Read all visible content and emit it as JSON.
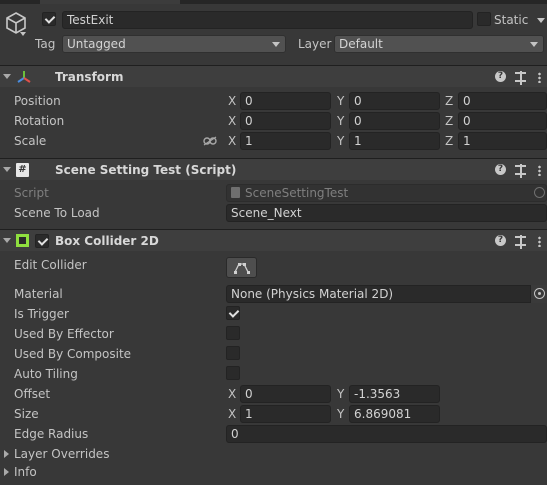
{
  "gameobject": {
    "name": "TestExit",
    "active": true,
    "static_label": "Static",
    "tag_label": "Tag",
    "tag_value": "Untagged",
    "layer_label": "Layer",
    "layer_value": "Default"
  },
  "transform": {
    "title": "Transform",
    "position_label": "Position",
    "rotation_label": "Rotation",
    "scale_label": "Scale",
    "axis_x": "X",
    "axis_y": "Y",
    "axis_z": "Z",
    "position": {
      "x": "0",
      "y": "0",
      "z": "0"
    },
    "rotation": {
      "x": "0",
      "y": "0",
      "z": "0"
    },
    "scale": {
      "x": "1",
      "y": "1",
      "z": "1"
    }
  },
  "script_component": {
    "title": "Scene Setting Test (Script)",
    "script_label": "Script",
    "script_value": "SceneSettingTest",
    "scene_label": "Scene To Load",
    "scene_value": "Scene_Next"
  },
  "box_collider": {
    "title": "Box Collider 2D",
    "enabled": true,
    "edit_collider_label": "Edit Collider",
    "material_label": "Material",
    "material_value": "None (Physics Material 2D)",
    "is_trigger_label": "Is Trigger",
    "is_trigger": true,
    "used_by_effector_label": "Used By Effector",
    "used_by_effector": false,
    "used_by_composite_label": "Used By Composite",
    "used_by_composite": false,
    "auto_tiling_label": "Auto Tiling",
    "auto_tiling": false,
    "offset_label": "Offset",
    "offset": {
      "x": "0",
      "y": "-1.3563"
    },
    "size_label": "Size",
    "size": {
      "x": "1",
      "y": "6.869081"
    },
    "edge_radius_label": "Edge Radius",
    "edge_radius": "0",
    "layer_overrides_label": "Layer Overrides",
    "info_label": "Info"
  },
  "icons": {
    "gameobject": "cube-icon",
    "transform": "transform-axes-icon",
    "script": "script-hash-icon",
    "collider": "box-collider-icon",
    "help": "help-icon",
    "presets": "presets-icon",
    "menu": "kebab-menu-icon",
    "link": "link-icon",
    "object_picker": "object-picker-icon"
  },
  "colors": {
    "background": "#383838",
    "header": "#3e3e3e",
    "field": "#2a2a2a",
    "collider_green": "#8fdf3f",
    "transform_red": "#e0504a",
    "transform_green": "#6cbf3a",
    "transform_blue": "#4a8de0"
  }
}
